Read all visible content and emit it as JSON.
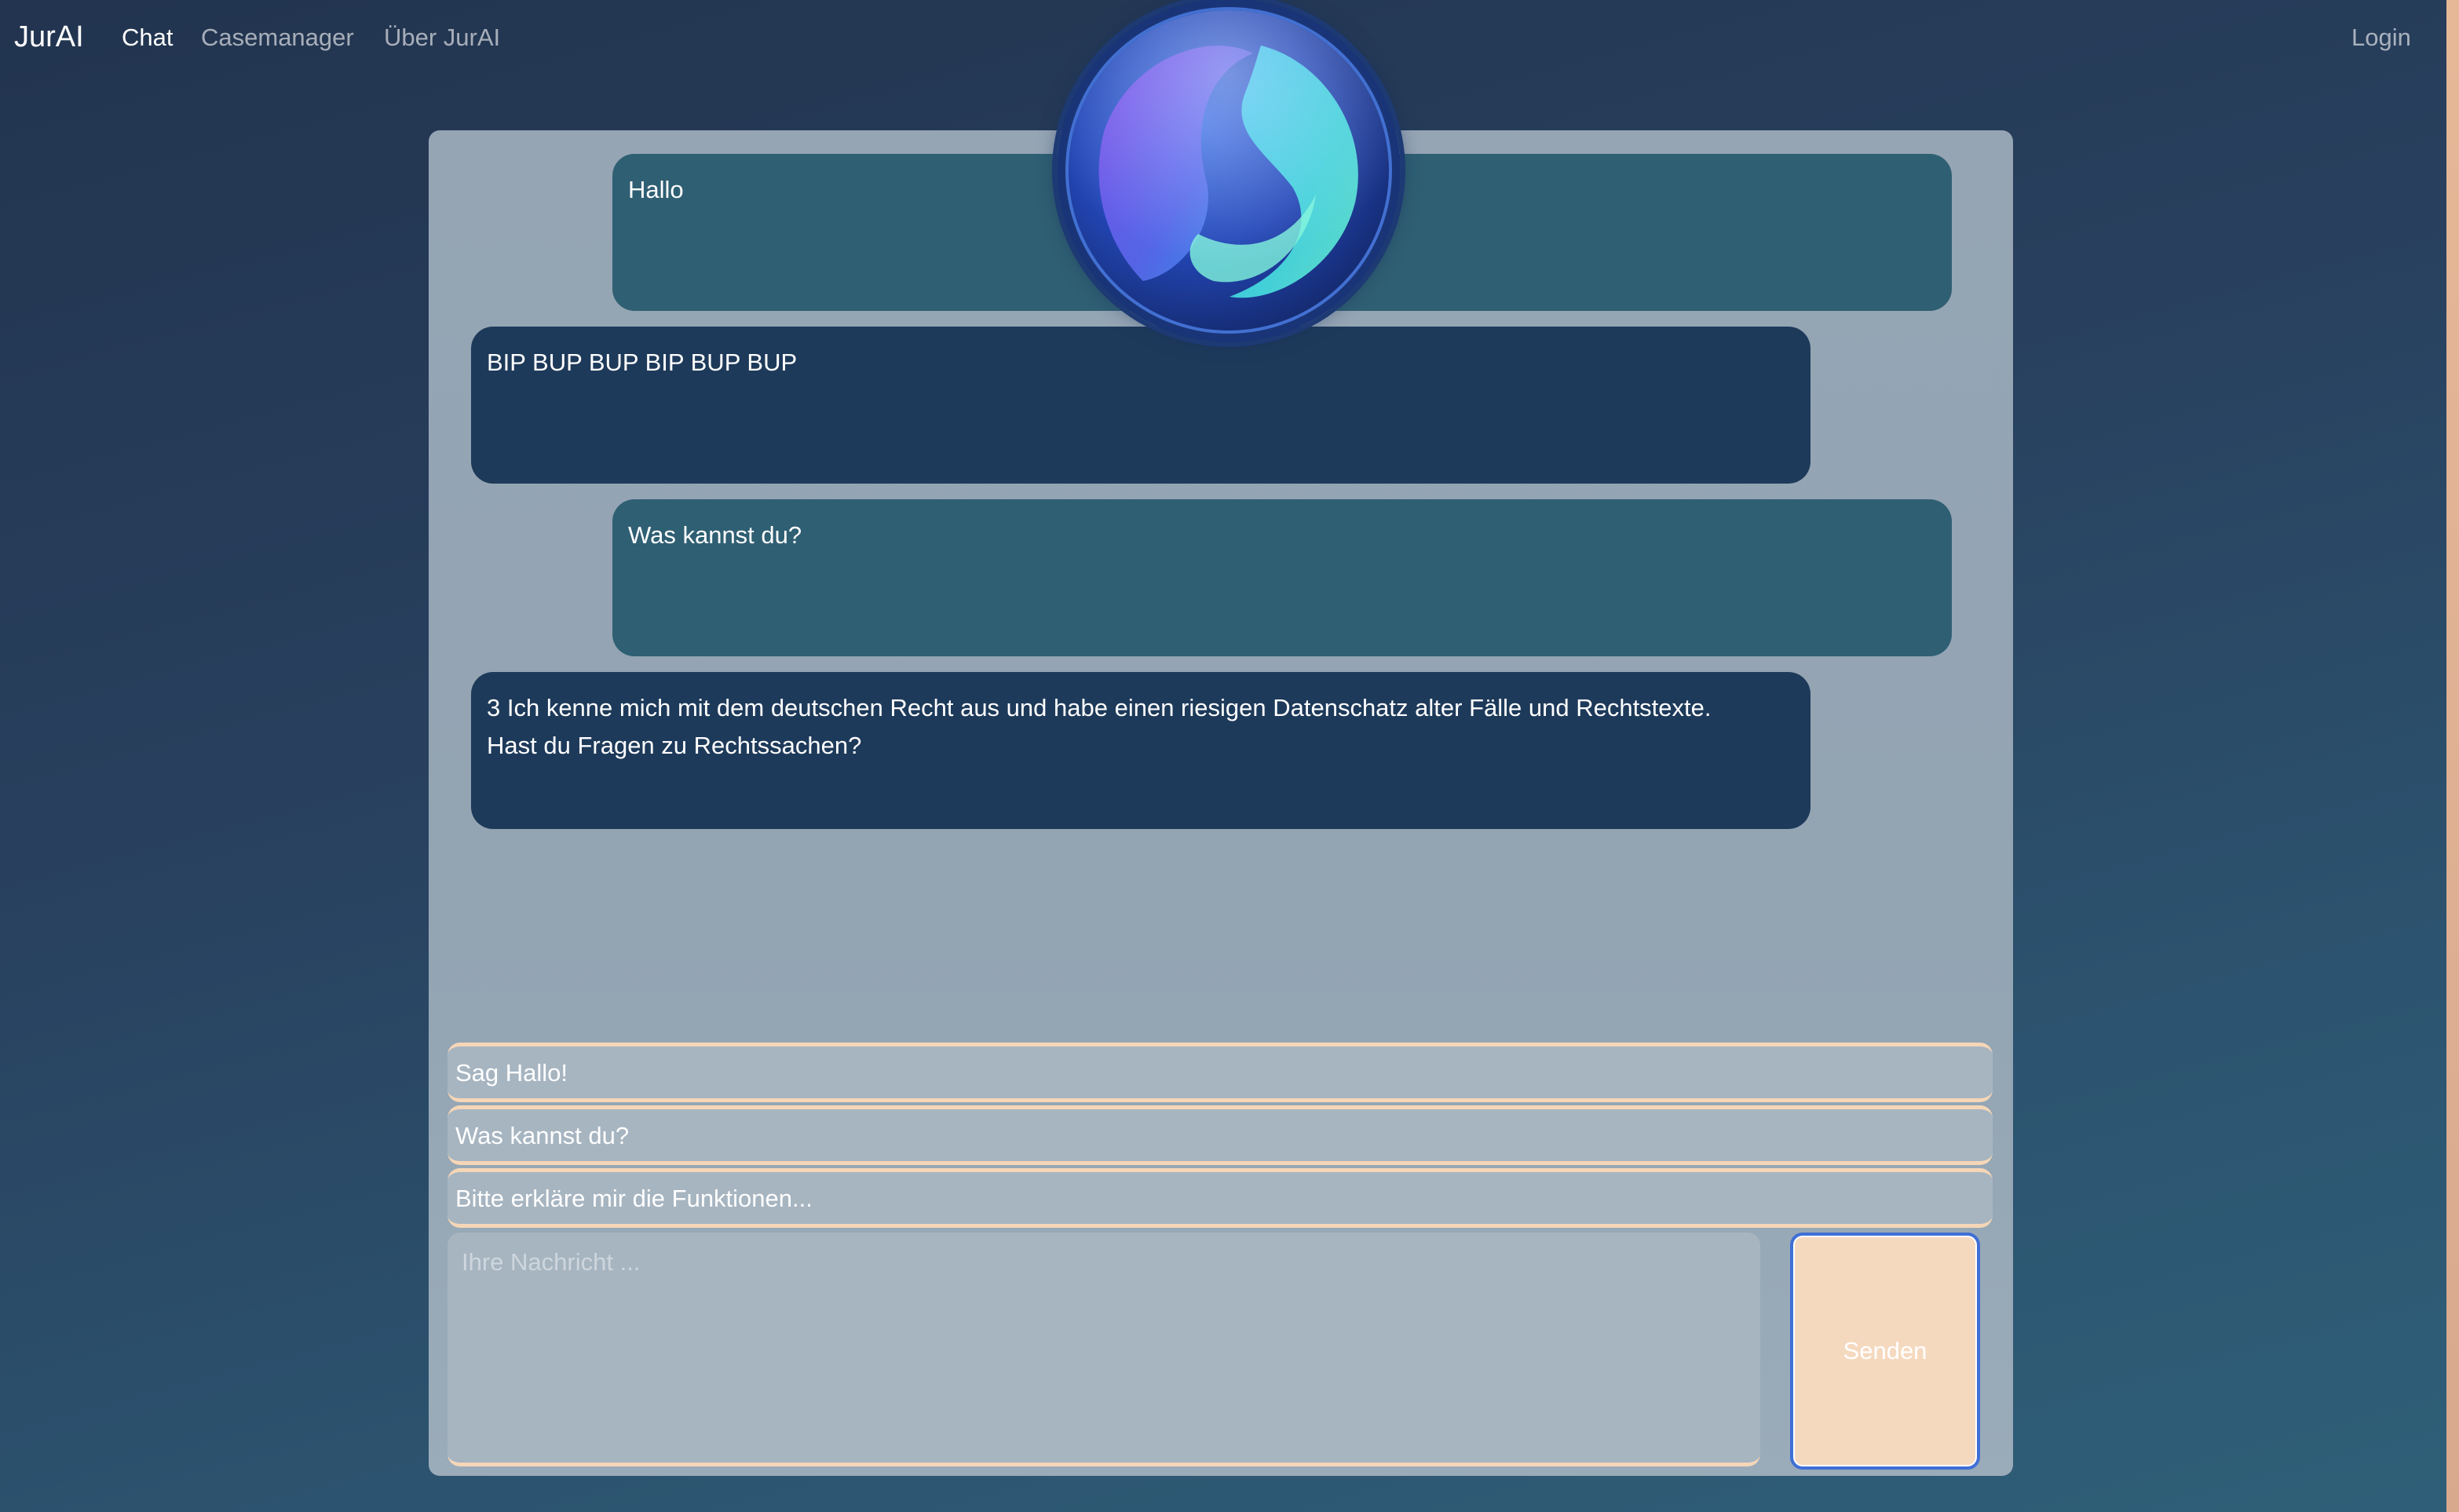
{
  "navbar": {
    "brand": "JurAI",
    "links": [
      "Chat",
      "Casemanager",
      "Über JurAI"
    ],
    "login": "Login"
  },
  "chat": {
    "messages": [
      {
        "role": "user",
        "text": "Hallo"
      },
      {
        "role": "bot",
        "text": "BIP BUP BUP BIP BUP BUP"
      },
      {
        "role": "user",
        "text": "Was kannst du?"
      },
      {
        "role": "bot",
        "lines": [
          "3 Ich kenne mich mit dem deutschen Recht aus und habe einen riesigen Datenschatz alter Fälle und Rechtstexte.",
          "Hast du Fragen zu Rechtssachen?"
        ]
      }
    ],
    "suggestions": [
      "Sag Hallo!",
      "Was kannst du?",
      "Bitte erkläre mir die Funktionen..."
    ],
    "input_placeholder": "Ihre Nachricht ...",
    "input_value": "",
    "send_label": "Senden"
  },
  "colors": {
    "user_bubble": "#2f5f73",
    "bot_bubble": "#1e3a5a",
    "accent": "#f5d9bf",
    "panel": "#95a5b4"
  },
  "icons": {
    "orb": "ai-orb-icon"
  }
}
